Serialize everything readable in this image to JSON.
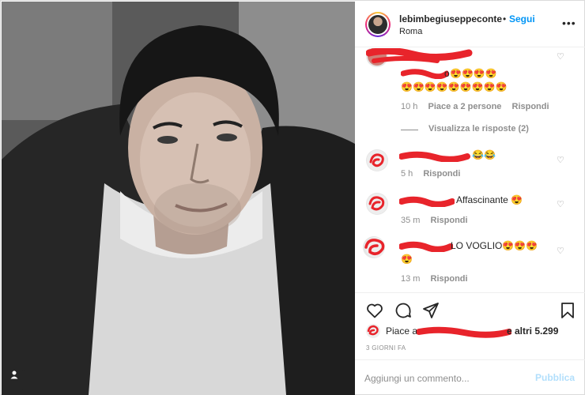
{
  "post": {
    "username": "lebimbegiuseppeconte",
    "separator": "•",
    "follow_label": "Segui",
    "location": "Roma",
    "more_icon": "more-horizontal-icon"
  },
  "comments": [
    {
      "text_tail": "o",
      "emojis_line1": "😍😍😍😍",
      "emojis_line2": "😍😍😍😍😍😍😍😍😍",
      "time": "10 h",
      "likes": "Piace a 2 persone",
      "reply": "Rispondi",
      "view_replies": "Visualizza le risposte (2)"
    },
    {
      "text_tail": "😂😂",
      "time": "5 h",
      "reply": "Rispondi"
    },
    {
      "text_tail": "Affascinante 😍",
      "time": "35 m",
      "reply": "Rispondi"
    },
    {
      "text_tail": "LO VOGLIO😍😍😍",
      "emojis_line2": "😍",
      "time": "13 m",
      "reply": "Rispondi"
    }
  ],
  "actions": {
    "like_icon": "heart-icon",
    "comment_icon": "comment-icon",
    "share_icon": "paper-plane-icon",
    "save_icon": "bookmark-icon"
  },
  "likes_summary": {
    "prefix": "Piace a",
    "suffix": "e altri 5.299"
  },
  "date_label": "3 GIORNI FA",
  "add_comment": {
    "placeholder": "Aggiungi un commento...",
    "publish_label": "Pubblica"
  },
  "colors": {
    "accent": "#0095f6",
    "publish_disabled": "#b2dffc",
    "redaction": "#e8242b",
    "meta_text": "#8e8e8e"
  }
}
